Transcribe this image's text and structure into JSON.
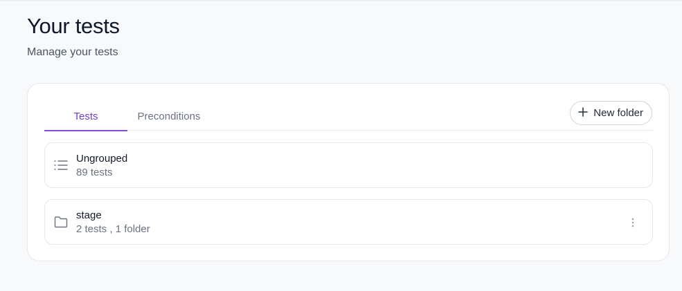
{
  "header": {
    "title": "Your tests",
    "subtitle": "Manage your tests"
  },
  "tabs": [
    {
      "label": "Tests",
      "active": true
    },
    {
      "label": "Preconditions",
      "active": false
    }
  ],
  "actions": {
    "new_folder_label": "New folder",
    "new_folder_icon": "plus-icon"
  },
  "rows": [
    {
      "icon": "list-icon",
      "title": "Ungrouped",
      "meta": "89 tests"
    },
    {
      "icon": "folder-icon",
      "title": "stage",
      "meta": "2 tests , 1 folder",
      "menu_icon": "more-vertical-icon"
    }
  ],
  "colors": {
    "accent": "#7c4ddd",
    "page_background": "#f8f9fb",
    "muted_text": "#6b7280"
  }
}
